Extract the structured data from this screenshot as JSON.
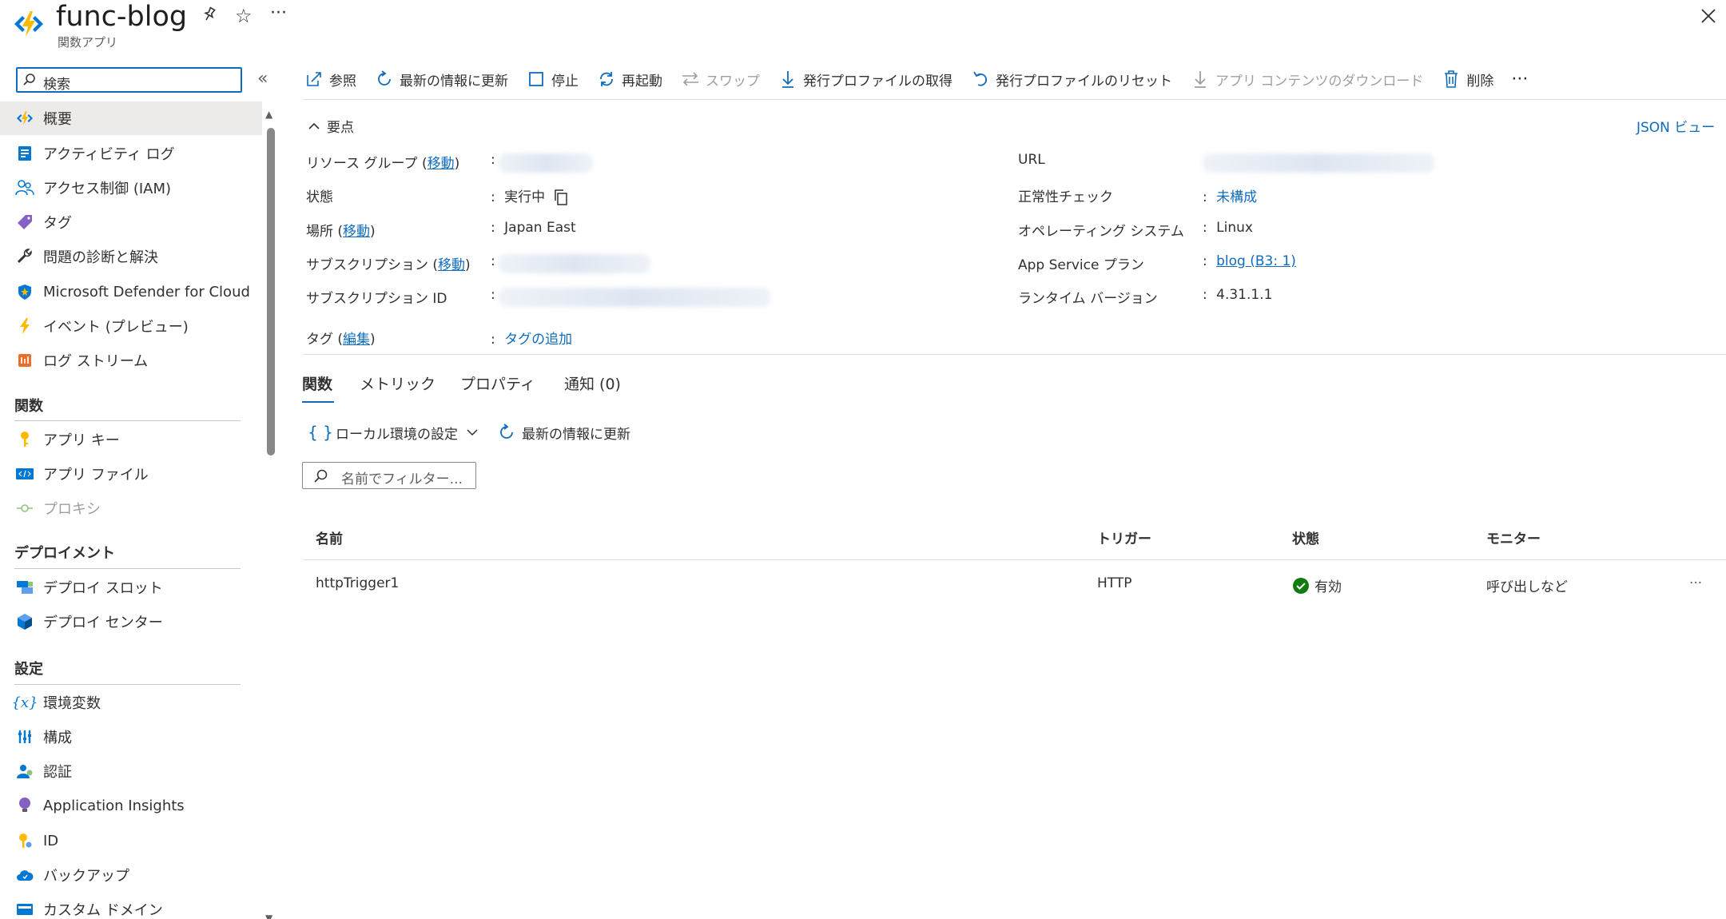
{
  "header": {
    "title": "func-blog",
    "subtitle": "関数アプリ",
    "icons": [
      "function-app-icon",
      "pin-icon",
      "star-icon",
      "more-icon",
      "close-icon"
    ]
  },
  "sidebar": {
    "search_placeholder": "検索",
    "items_top": [
      {
        "label": "概要",
        "icon": "lightning-icon",
        "active": true
      },
      {
        "label": "アクティビティ ログ",
        "icon": "activity-log-icon"
      },
      {
        "label": "アクセス制御 (IAM)",
        "icon": "people-icon"
      },
      {
        "label": "タグ",
        "icon": "tag-icon"
      },
      {
        "label": "問題の診断と解決",
        "icon": "wrench-icon"
      },
      {
        "label": "Microsoft Defender for Cloud",
        "icon": "shield-icon"
      },
      {
        "label": "イベント (プレビュー)",
        "icon": "bolt-icon"
      },
      {
        "label": "ログ ストリーム",
        "icon": "log-stream-icon"
      }
    ],
    "section_functions": "関数",
    "items_functions": [
      {
        "label": "アプリ キー",
        "icon": "key-icon"
      },
      {
        "label": "アプリ ファイル",
        "icon": "code-file-icon"
      },
      {
        "label": "プロキシ",
        "icon": "proxy-icon",
        "disabled": true
      }
    ],
    "section_deployment": "デプロイメント",
    "items_deployment": [
      {
        "label": "デプロイ スロット",
        "icon": "slots-icon"
      },
      {
        "label": "デプロイ センター",
        "icon": "cube-icon"
      }
    ],
    "section_settings": "設定",
    "items_settings": [
      {
        "label": "環境変数",
        "icon": "variable-icon"
      },
      {
        "label": "構成",
        "icon": "sliders-icon"
      },
      {
        "label": "認証",
        "icon": "auth-icon"
      },
      {
        "label": "Application Insights",
        "icon": "lightbulb-icon"
      },
      {
        "label": "ID",
        "icon": "identity-icon"
      },
      {
        "label": "バックアップ",
        "icon": "backup-icon"
      },
      {
        "label": "カスタム ドメイン",
        "icon": "domain-icon"
      }
    ]
  },
  "toolbar": {
    "browse": "参照",
    "refresh": "最新の情報に更新",
    "stop": "停止",
    "restart": "再起動",
    "swap": "スワップ",
    "get_profile": "発行プロファイルの取得",
    "reset_profile": "発行プロファイルのリセット",
    "download_content": "アプリ コンテンツのダウンロード",
    "delete": "削除",
    "more": "···"
  },
  "essentials": {
    "toggle_label": "要点",
    "json_view": "JSON ビュー",
    "resource_group_label": "リソース グループ",
    "move_link": "移動",
    "status_label": "状態",
    "status_value": "実行中",
    "location_label": "場所",
    "location_value": "Japan East",
    "subscription_label": "サブスクリプション",
    "subscription_id_label": "サブスクリプション ID",
    "tags_label": "タグ",
    "edit_link": "編集",
    "add_tags": "タグの追加",
    "url_label": "URL",
    "health_check_label": "正常性チェック",
    "health_check_value": "未構成",
    "os_label": "オペレーティング システム",
    "os_value": "Linux",
    "plan_label": "App Service プラン",
    "plan_value": "blog (B3: 1)",
    "runtime_label": "ランタイム バージョン",
    "runtime_value": "4.31.1.1",
    "colon": ":"
  },
  "tabs": [
    {
      "label": "関数",
      "active": true
    },
    {
      "label": "メトリック"
    },
    {
      "label": "プロパティ"
    },
    {
      "label": "通知 (0)"
    }
  ],
  "functions": {
    "local_env": "ローカル環境の設定",
    "refresh": "最新の情報に更新",
    "filter_placeholder": "名前でフィルター...",
    "columns": [
      "名前",
      "トリガー",
      "状態",
      "モニター"
    ],
    "rows": [
      {
        "name": "httpTrigger1",
        "trigger": "HTTP",
        "status": "有効",
        "monitor": "呼び出しなど",
        "more": "···"
      }
    ]
  },
  "colors": {
    "accent": "#0f6cbd",
    "success": "#107c10",
    "active_bg": "#edebe9"
  }
}
